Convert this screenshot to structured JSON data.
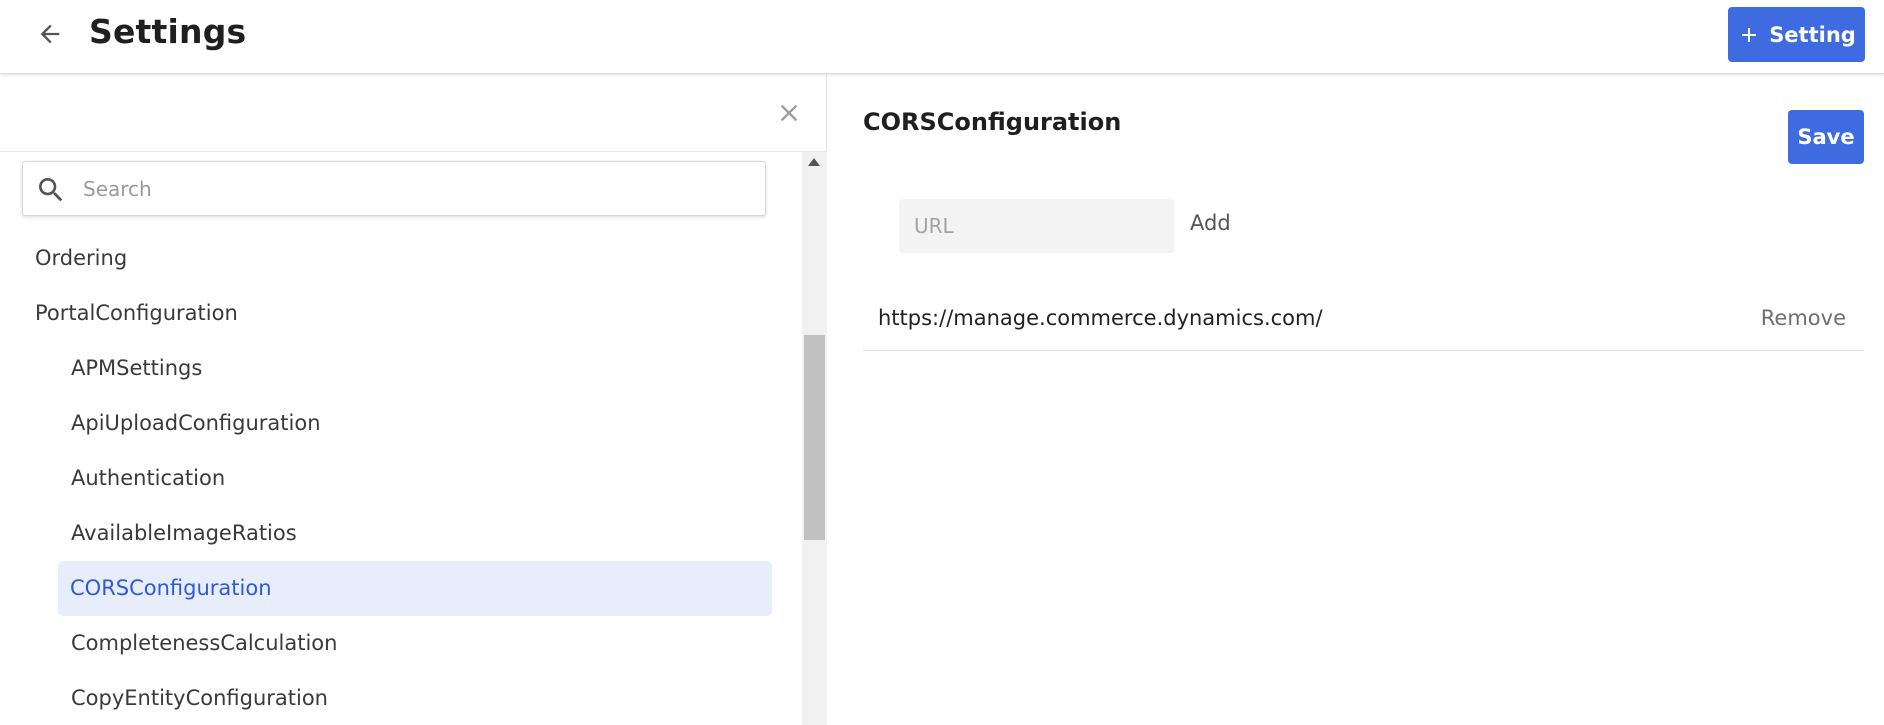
{
  "header": {
    "title": "Settings",
    "add_button_label": "Setting"
  },
  "sidebar": {
    "search_placeholder": "Search",
    "items": [
      {
        "label": "Ordering",
        "level": 0
      },
      {
        "label": "PortalConfiguration",
        "level": 0
      },
      {
        "label": "APMSettings",
        "level": 1
      },
      {
        "label": "ApiUploadConfiguration",
        "level": 1
      },
      {
        "label": "Authentication",
        "level": 1
      },
      {
        "label": "AvailableImageRatios",
        "level": 1
      },
      {
        "label": "CORSConfiguration",
        "level": 1,
        "selected": true
      },
      {
        "label": "CompletenessCalculation",
        "level": 1
      },
      {
        "label": "CopyEntityConfiguration",
        "level": 1
      }
    ]
  },
  "detail": {
    "title": "CORSConfiguration",
    "save_label": "Save",
    "url_placeholder": "URL",
    "add_label": "Add",
    "entries": [
      {
        "url": "https://manage.commerce.dynamics.com/",
        "remove_label": "Remove"
      }
    ]
  },
  "colors": {
    "accent": "#3f6be0",
    "selected_bg": "#e8edfb",
    "selected_text": "#2f5ad6"
  },
  "icons": {
    "back": "arrow-left-icon",
    "add": "plus-icon",
    "close": "close-icon",
    "search": "search-icon"
  }
}
